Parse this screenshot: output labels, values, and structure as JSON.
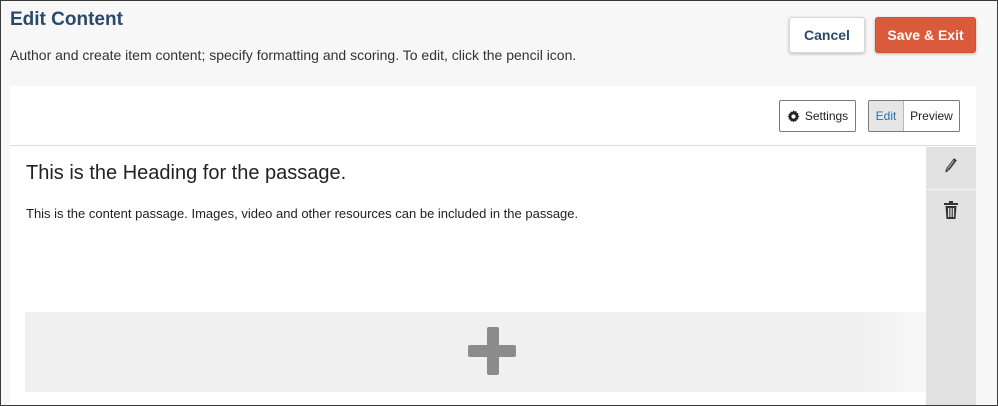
{
  "header": {
    "title": "Edit Content",
    "subtitle": "Author and create item content; specify formatting and scoring. To edit, click the pencil icon.",
    "cancel_label": "Cancel",
    "save_label": "Save & Exit"
  },
  "toolbar": {
    "settings_label": "Settings",
    "settings_icon": "gear-icon",
    "mode_options": [
      "Edit",
      "Preview"
    ],
    "mode_selected": "Edit"
  },
  "passage": {
    "heading": "This is the Heading for the passage.",
    "body": "This is the content passage.  Images, video and other resources can be included in the passage."
  },
  "side_actions": {
    "edit_icon": "pencil-icon",
    "delete_icon": "trash-icon"
  },
  "add_area": {
    "icon": "plus-icon"
  },
  "colors": {
    "title": "#2a4a6b",
    "primary_button": "#dc5a3c",
    "selected_mode_text": "#2a6ea8",
    "rail_background": "#e2e2e2",
    "add_icon": "#8c8c8c"
  }
}
